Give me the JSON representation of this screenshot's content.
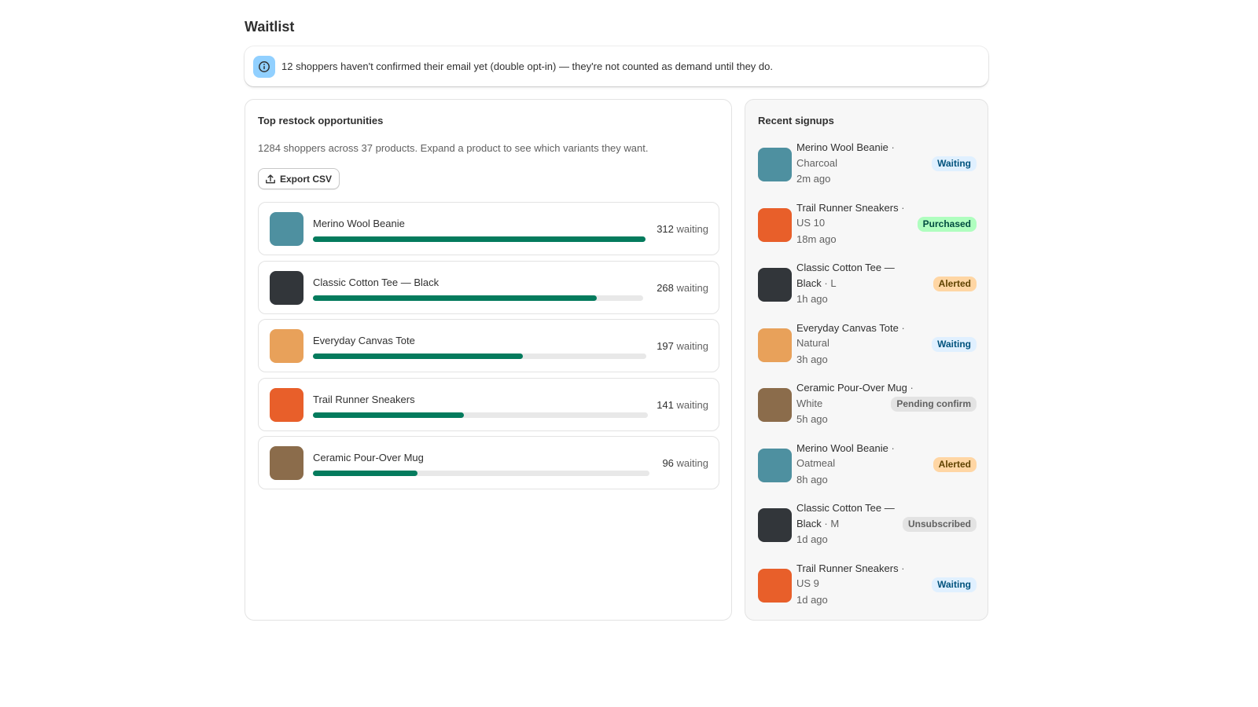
{
  "page": {
    "title": "Waitlist"
  },
  "banner": {
    "icon": "info-icon",
    "text": "12 shoppers haven't confirmed their email yet (double opt-in) — they're not counted as demand until they do."
  },
  "opportunities": {
    "title": "Top restock opportunities",
    "subtitle": "1284 shoppers across 37 products. Expand a product to see which variants they want.",
    "export_label": "Export CSV",
    "waiting_suffix": "waiting",
    "items": [
      {
        "name": "Merino Wool Beanie",
        "count": "312",
        "fill_percent": 100,
        "color": "#4e90a0"
      },
      {
        "name": "Classic Cotton Tee — Black",
        "count": "268",
        "fill_percent": 86,
        "color": "#32363a"
      },
      {
        "name": "Everyday Canvas Tote",
        "count": "197",
        "fill_percent": 63,
        "color": "#e8a15a"
      },
      {
        "name": "Trail Runner Sneakers",
        "count": "141",
        "fill_percent": 45,
        "color": "#e85f2a"
      },
      {
        "name": "Ceramic Pour-Over Mug",
        "count": "96",
        "fill_percent": 31,
        "color": "#8b6c4b"
      }
    ]
  },
  "recent": {
    "title": "Recent signups",
    "items": [
      {
        "product": "Merino Wool Beanie",
        "variant": "Charcoal",
        "time": "2m ago",
        "status": "Waiting",
        "color": "#4e90a0",
        "badge_bg": "#e0f0ff",
        "badge_fg": "#00527c"
      },
      {
        "product": "Trail Runner Sneakers",
        "variant": "US 10",
        "time": "18m ago",
        "status": "Purchased",
        "color": "#e85f2a",
        "badge_bg": "#affebf",
        "badge_fg": "#014b40"
      },
      {
        "product": "Classic Cotton Tee — Black",
        "variant": "L",
        "time": "1h ago",
        "status": "Alerted",
        "color": "#32363a",
        "badge_bg": "#ffd6a4",
        "badge_fg": "#5e4200"
      },
      {
        "product": "Everyday Canvas Tote",
        "variant": "Natural",
        "time": "3h ago",
        "status": "Waiting",
        "color": "#e8a15a",
        "badge_bg": "#e0f0ff",
        "badge_fg": "#00527c"
      },
      {
        "product": "Ceramic Pour-Over Mug",
        "variant": "White",
        "time": "5h ago",
        "status": "Pending confirm",
        "color": "#8b6c4b",
        "badge_bg": "#e3e3e3",
        "badge_fg": "#616161"
      },
      {
        "product": "Merino Wool Beanie",
        "variant": "Oatmeal",
        "time": "8h ago",
        "status": "Alerted",
        "color": "#4e90a0",
        "badge_bg": "#ffd6a4",
        "badge_fg": "#5e4200"
      },
      {
        "product": "Classic Cotton Tee — Black",
        "variant": "M",
        "time": "1d ago",
        "status": "Unsubscribed",
        "color": "#32363a",
        "badge_bg": "#e3e3e3",
        "badge_fg": "#616161"
      },
      {
        "product": "Trail Runner Sneakers",
        "variant": "US 9",
        "time": "1d ago",
        "status": "Waiting",
        "color": "#e85f2a",
        "badge_bg": "#e0f0ff",
        "badge_fg": "#00527c"
      }
    ]
  }
}
